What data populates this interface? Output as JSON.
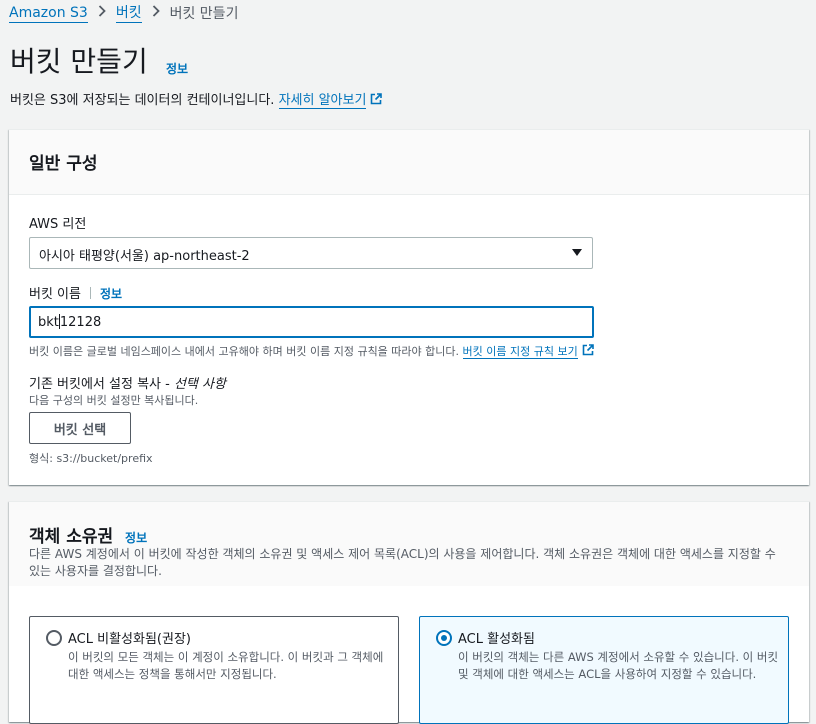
{
  "breadcrumb": {
    "root": "Amazon S3",
    "buckets": "버킷",
    "current": "버킷 만들기"
  },
  "page": {
    "title": "버킷 만들기",
    "info": "정보",
    "description": "버킷은 S3에 저장되는 데이터의 컨테이너입니다.",
    "learn_more": "자세히 알아보기"
  },
  "general": {
    "title": "일반 구성",
    "region_label": "AWS 리전",
    "region_value": "아시아 태평양(서울) ap-northeast-2",
    "name_label": "버킷 이름",
    "name_info": "정보",
    "name_value_a": "bkt",
    "name_value_b": "12128",
    "name_hint": "버킷 이름은 글로벌 네임스페이스 내에서 고유해야 하며 버킷 이름 지정 규칙을 따라야 합니다.",
    "name_rules_link": "버킷 이름 지정 규칙 보기",
    "copy_label": "기존 버킷에서 설정 복사 - ",
    "copy_optional": "선택 사항",
    "copy_hint": "다음 구성의 버킷 설정만 복사됩니다.",
    "choose_button": "버킷 선택",
    "format_hint": "형식: s3://bucket/prefix"
  },
  "ownership": {
    "title": "객체 소유권",
    "info": "정보",
    "description": "다른 AWS 계정에서 이 버킷에 작성한 객체의 소유권 및 액세스 제어 목록(ACL)의 사용을 제어합니다. 객체 소유권은 객체에 대한 액세스를 지정할 수 있는 사용자를 결정합니다.",
    "options": [
      {
        "title": "ACL 비활성화됨(권장)",
        "desc": "이 버킷의 모든 객체는 이 계정이 소유합니다. 이 버킷과 그 객체에 대한 액세스는 정책을 통해서만 지정됩니다.",
        "selected": false
      },
      {
        "title": "ACL 활성화됨",
        "desc": "이 버킷의 객체는 다른 AWS 계정에서 소유할 수 있습니다. 이 버킷 및 객체에 대한 액세스는 ACL을 사용하여 지정할 수 있습니다.",
        "selected": true
      }
    ]
  },
  "colors": {
    "link": "#0073bb",
    "background": "#f2f3f3",
    "text": "#16191f",
    "muted": "#545b64"
  }
}
